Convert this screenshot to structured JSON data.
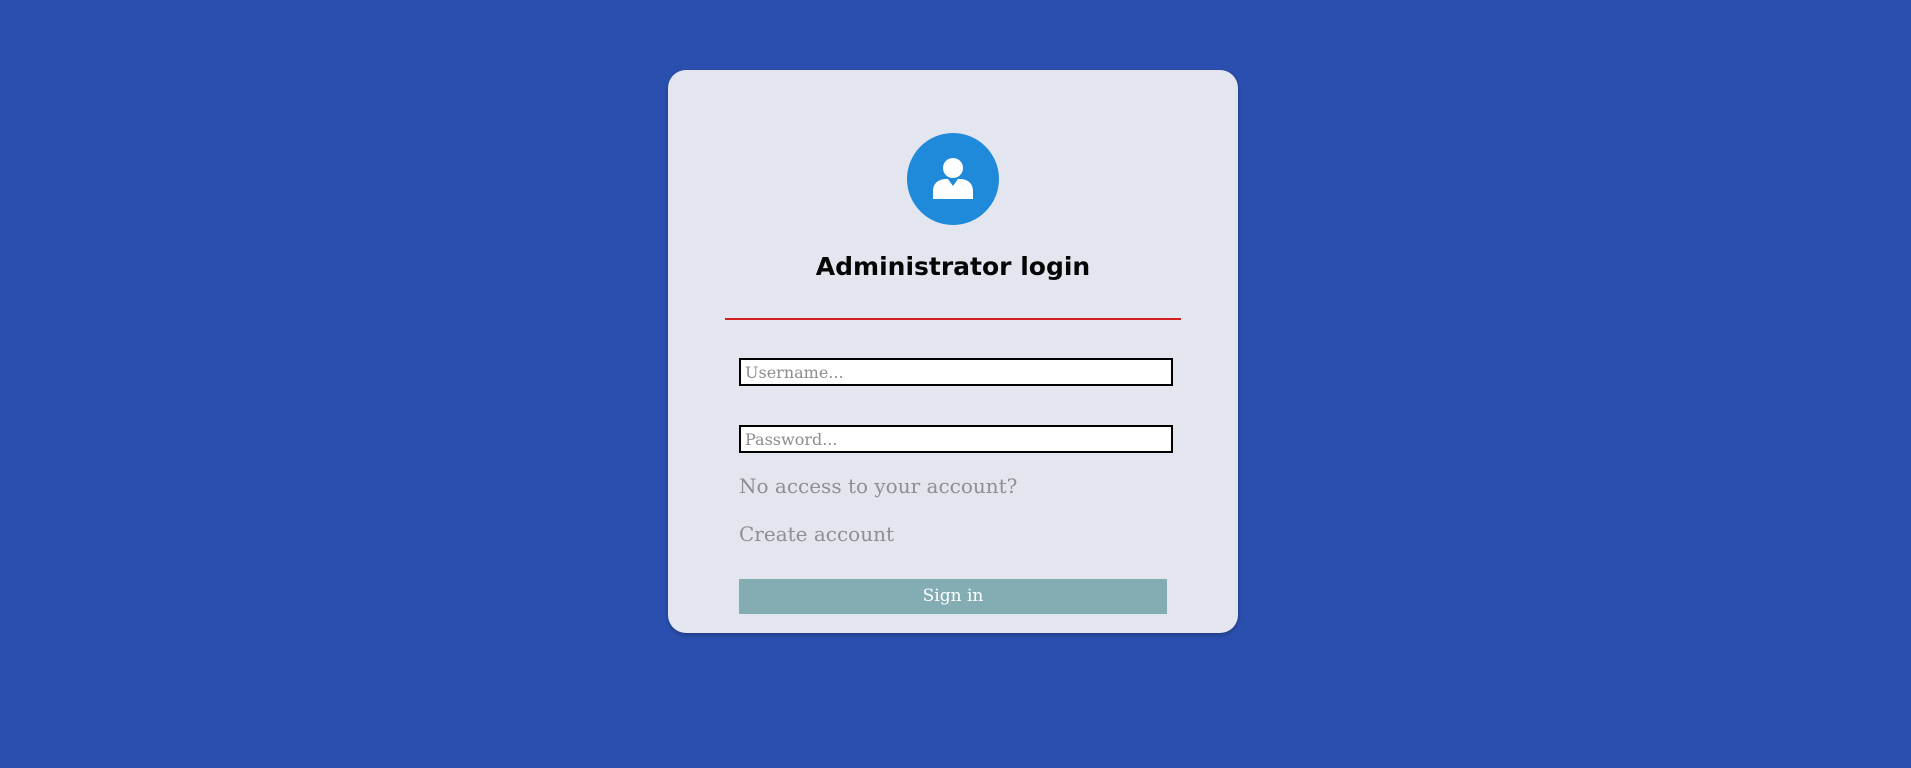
{
  "login": {
    "title": "Administrator login",
    "avatar_icon": "user-icon",
    "username_placeholder": "Username...",
    "password_placeholder": "Password...",
    "username_value": "",
    "password_value": "",
    "no_access_link": "No access to your account?",
    "create_account_link": "Create account",
    "sign_in_label": "Sign in"
  },
  "colors": {
    "background": "#2b4fae",
    "card": "#e3e6ee",
    "avatar": "#1e8ad9",
    "divider": "#d2201e",
    "sign_in_button": "#84adb3",
    "link_text": "#8f8f91"
  }
}
